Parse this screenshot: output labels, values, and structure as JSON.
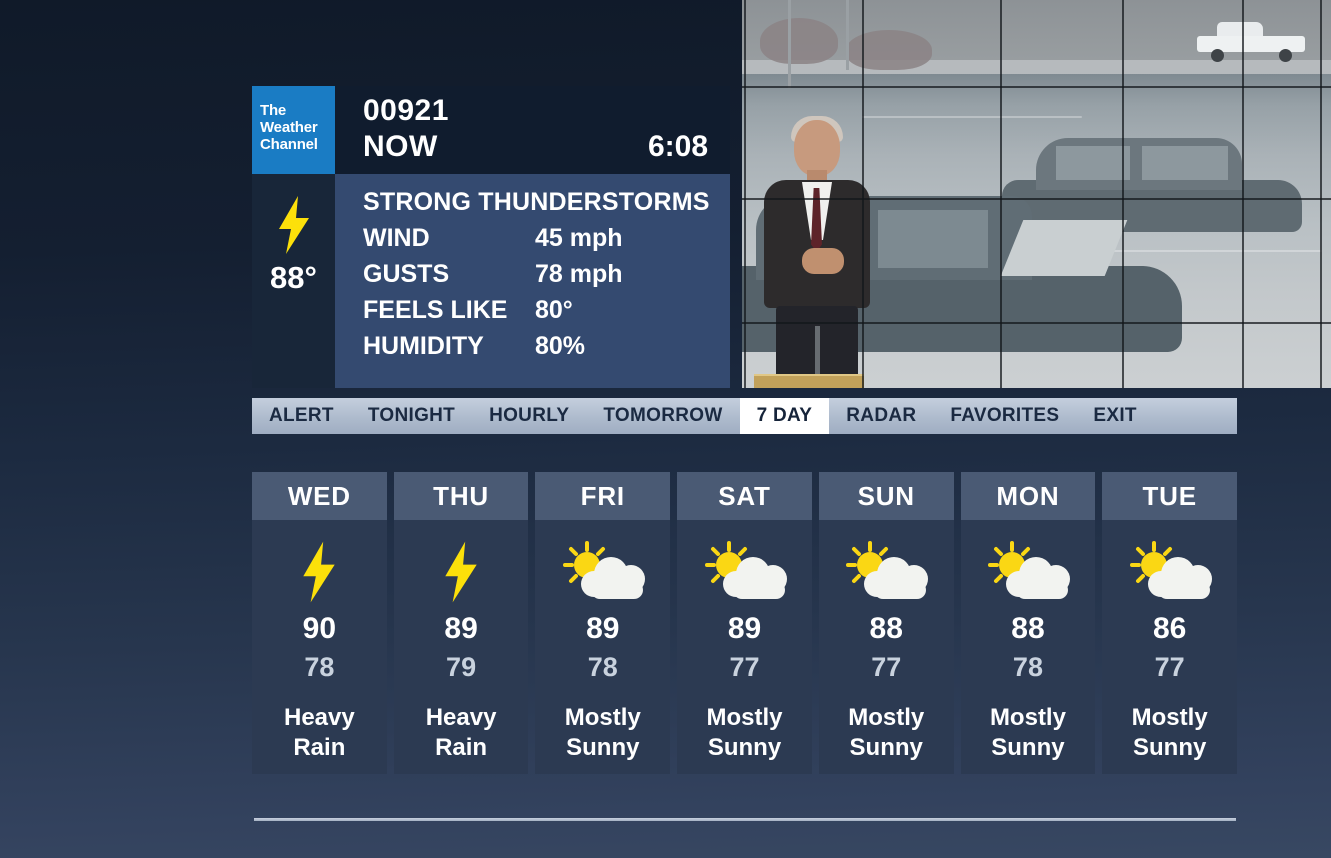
{
  "brand": {
    "line1": "The",
    "line2": "Weather",
    "line3": "Channel",
    "color": "#1a7cc4"
  },
  "header": {
    "zip": "00921",
    "label": "NOW",
    "time": "6:08"
  },
  "current": {
    "icon": "lightning-icon",
    "temperature": "88°",
    "condition": "STRONG THUNDERSTORMS",
    "rows": [
      {
        "label": "WIND",
        "value": "45 mph"
      },
      {
        "label": "GUSTS",
        "value": "78 mph"
      },
      {
        "label": "FEELS LIKE",
        "value": "80°"
      },
      {
        "label": "HUMIDITY",
        "value": "80%"
      }
    ]
  },
  "nav": {
    "items": [
      {
        "label": "ALERT",
        "active": false
      },
      {
        "label": "TONIGHT",
        "active": false
      },
      {
        "label": "HOURLY",
        "active": false
      },
      {
        "label": "TOMORROW",
        "active": false
      },
      {
        "label": "7 DAY",
        "active": true
      },
      {
        "label": "RADAR",
        "active": false
      },
      {
        "label": "FAVORITES",
        "active": false
      },
      {
        "label": "EXIT",
        "active": false
      }
    ]
  },
  "forecast": {
    "days": [
      {
        "day": "WED",
        "icon": "lightning-icon",
        "high": "90",
        "low": "78",
        "desc_line1": "Heavy",
        "desc_line2": "Rain"
      },
      {
        "day": "THU",
        "icon": "lightning-icon",
        "high": "89",
        "low": "79",
        "desc_line1": "Heavy",
        "desc_line2": "Rain"
      },
      {
        "day": "FRI",
        "icon": "sun-behind-cloud-icon",
        "high": "89",
        "low": "78",
        "desc_line1": "Mostly",
        "desc_line2": "Sunny"
      },
      {
        "day": "SAT",
        "icon": "sun-behind-cloud-icon",
        "high": "89",
        "low": "77",
        "desc_line1": "Mostly",
        "desc_line2": "Sunny"
      },
      {
        "day": "SUN",
        "icon": "sun-behind-cloud-icon",
        "high": "88",
        "low": "77",
        "desc_line1": "Mostly",
        "desc_line2": "Sunny"
      },
      {
        "day": "MON",
        "icon": "sun-behind-cloud-icon",
        "high": "88",
        "low": "78",
        "desc_line1": "Mostly",
        "desc_line2": "Sunny"
      },
      {
        "day": "TUE",
        "icon": "sun-behind-cloud-icon",
        "high": "86",
        "low": "77",
        "desc_line1": "Mostly",
        "desc_line2": "Sunny"
      }
    ]
  },
  "video": {
    "description": "meteorologist-in-front-of-flooded-street-video-wall"
  },
  "colors": {
    "bolt_yellow": "#FCE00A",
    "panel_blue": "#344a70",
    "header_navy": "#101c2e",
    "card_header": "#4a5a74",
    "card_body": "#2c3a52",
    "nav_bg": "#aebbcd"
  }
}
